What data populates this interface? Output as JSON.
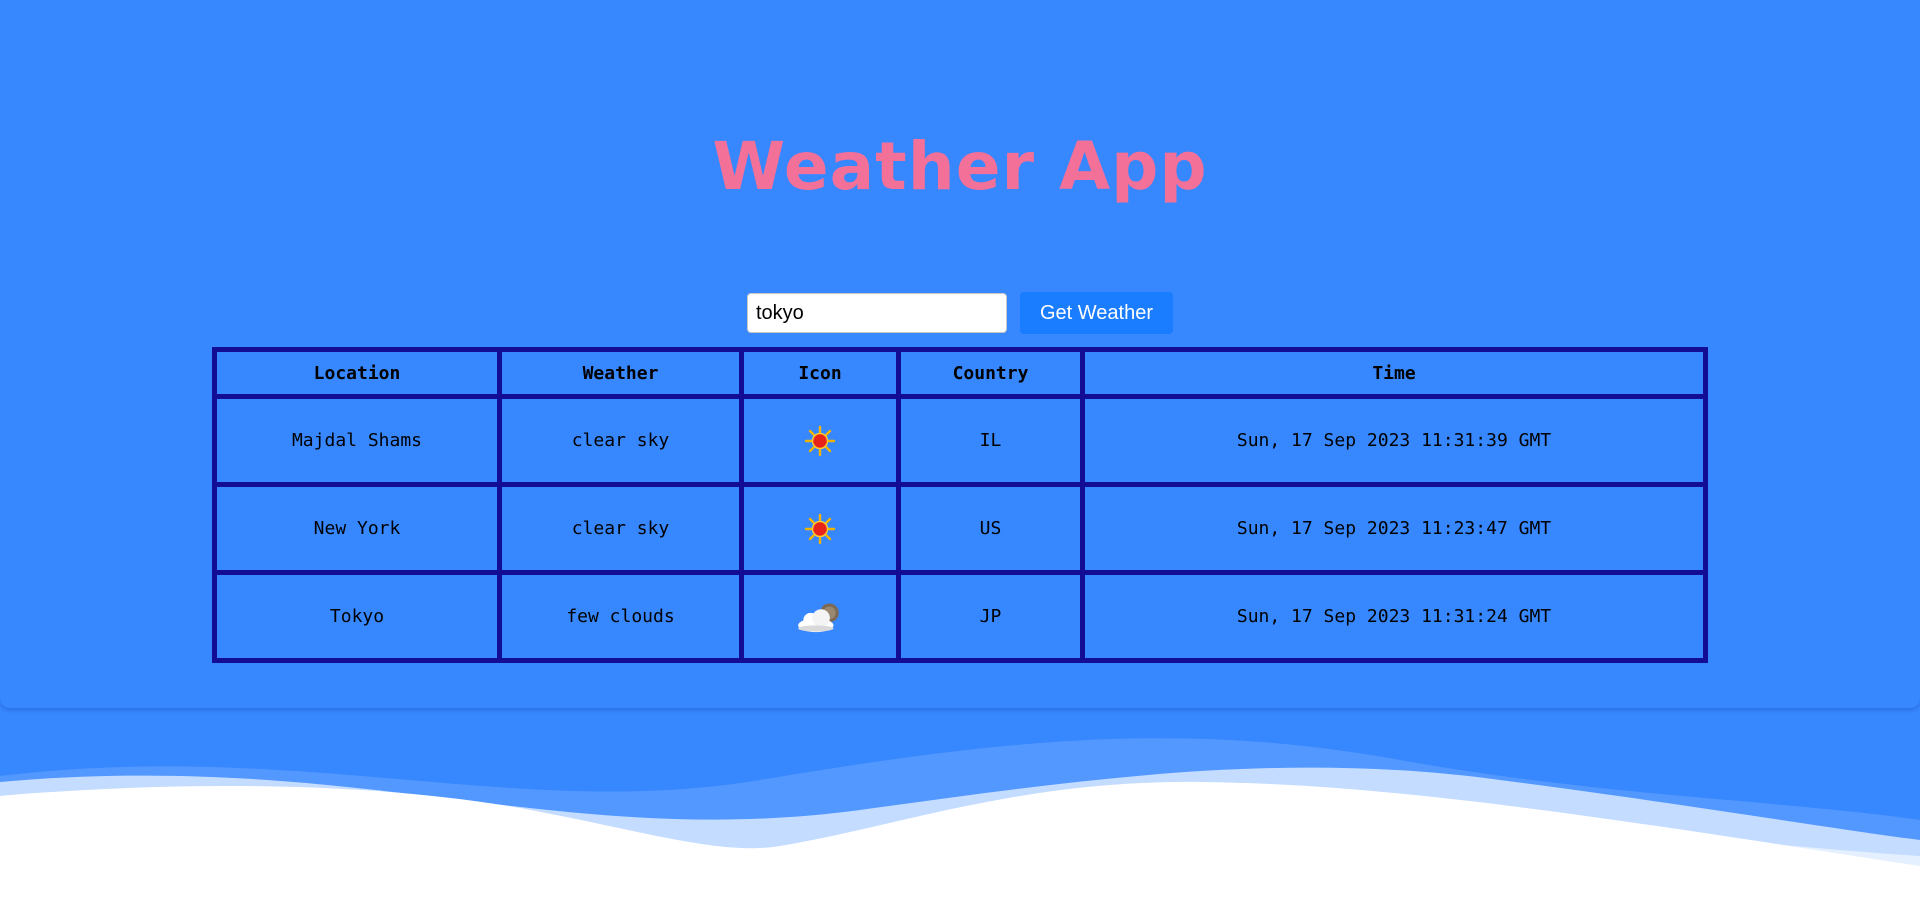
{
  "app": {
    "title": "Weather App"
  },
  "search": {
    "value": "tokyo",
    "button_label": "Get Weather"
  },
  "table": {
    "headers": [
      "Location",
      "Weather",
      "Icon",
      "Country",
      "Time"
    ],
    "rows": [
      {
        "location": "Majdal Shams",
        "weather": "clear sky",
        "icon": "clear-sky-icon",
        "country": "IL",
        "time": "Sun, 17 Sep 2023 11:31:39 GMT"
      },
      {
        "location": "New York",
        "weather": "clear sky",
        "icon": "clear-sky-icon",
        "country": "US",
        "time": "Sun, 17 Sep 2023 11:23:47 GMT"
      },
      {
        "location": "Tokyo",
        "weather": "few clouds",
        "icon": "few-clouds-icon",
        "country": "JP",
        "time": "Sun, 17 Sep 2023 11:31:24 GMT"
      }
    ]
  },
  "colors": {
    "background": "#3787ff",
    "title": "#f37098",
    "button": "#1a7cff",
    "table_border": "#120d94"
  }
}
